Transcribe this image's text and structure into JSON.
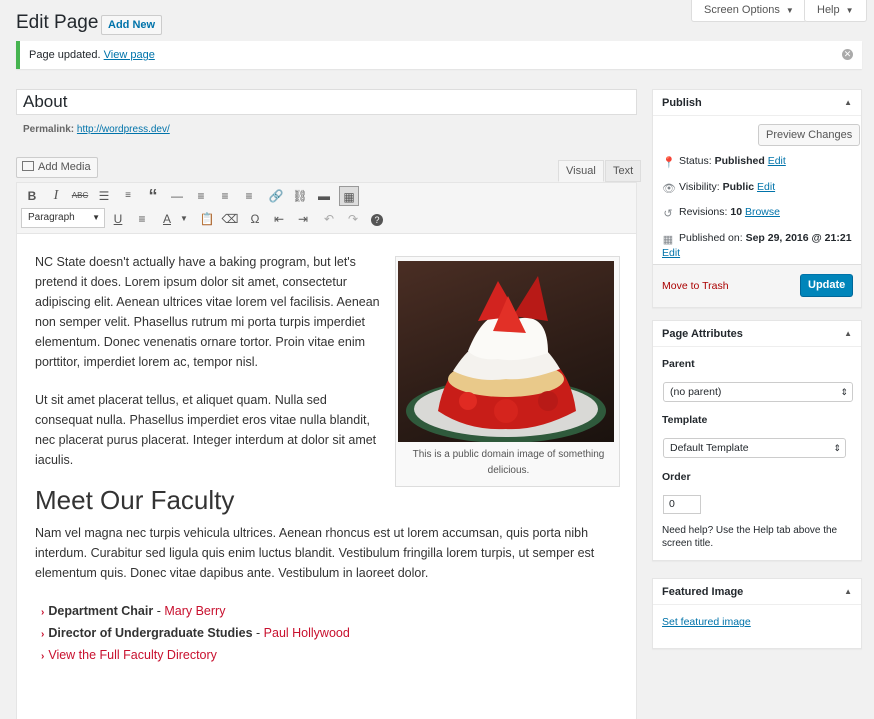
{
  "header": {
    "title": "Edit Page",
    "add_new": "Add New",
    "screen_options": "Screen Options",
    "help": "Help"
  },
  "notice": {
    "text": "Page updated.",
    "link": "View page"
  },
  "editor": {
    "title_value": "About",
    "permalink_label": "Permalink:",
    "permalink_url": "http://wordpress.dev/",
    "add_media": "Add Media",
    "tab_visual": "Visual",
    "tab_text": "Text",
    "format_select": "Paragraph",
    "content": {
      "para1": "NC State doesn't actually have a baking program, but let's pretend it does. Lorem ipsum dolor sit amet, consectetur adipiscing elit. Aenean ultrices vitae lorem vel facilisis. Aenean non semper velit. Phasellus rutrum mi porta turpis imperdiet elementum. Donec venenatis ornare tortor. Proin vitae enim porttitor, imperdiet lorem ac, tempor nisl.",
      "para2": "Ut sit amet placerat tellus, et aliquet quam. Nulla sed consequat nulla. Phasellus imperdiet eros vitae nulla blandit, nec placerat purus placerat. Integer interdum at dolor sit amet iaculis.",
      "image_caption": "This is a public domain image of something delicious.",
      "heading": "Meet Our Faculty",
      "para3": "Nam vel magna nec turpis vehicula ultrices. Aenean rhoncus est ut lorem accumsan, quis porta nibh interdum. Curabitur sed ligula quis enim luctus blandit. Vestibulum fringilla lorem turpis, ut semper est elementum quis. Donec vitae dapibus ante. Vestibulum in laoreet dolor.",
      "list": [
        {
          "role": "Department Chair",
          "sep": " - ",
          "name": "Mary Berry"
        },
        {
          "role": "Director of Undergraduate Studies",
          "sep": " - ",
          "name": "Paul Hollywood"
        },
        {
          "link": "View the Full Faculty Directory"
        }
      ]
    }
  },
  "publish": {
    "title": "Publish",
    "preview": "Preview Changes",
    "status_label": "Status:",
    "status_value": "Published",
    "visibility_label": "Visibility:",
    "visibility_value": "Public",
    "revisions_label": "Revisions:",
    "revisions_value": "10",
    "browse": "Browse",
    "published_label": "Published on:",
    "published_value": "Sep 29, 2016 @ 21:21",
    "edit": "Edit",
    "trash": "Move to Trash",
    "update": "Update"
  },
  "page_attributes": {
    "title": "Page Attributes",
    "parent_label": "Parent",
    "parent_value": "(no parent)",
    "template_label": "Template",
    "template_value": "Default Template",
    "order_label": "Order",
    "order_value": "0",
    "help": "Need help? Use the Help tab above the screen title."
  },
  "featured_image": {
    "title": "Featured Image",
    "link": "Set featured image"
  },
  "colors": {
    "accent": "#0073aa",
    "primary_button": "#0085ba",
    "notice_success": "#46b450",
    "trash": "#a00",
    "faculty_red": "#c8102e"
  }
}
